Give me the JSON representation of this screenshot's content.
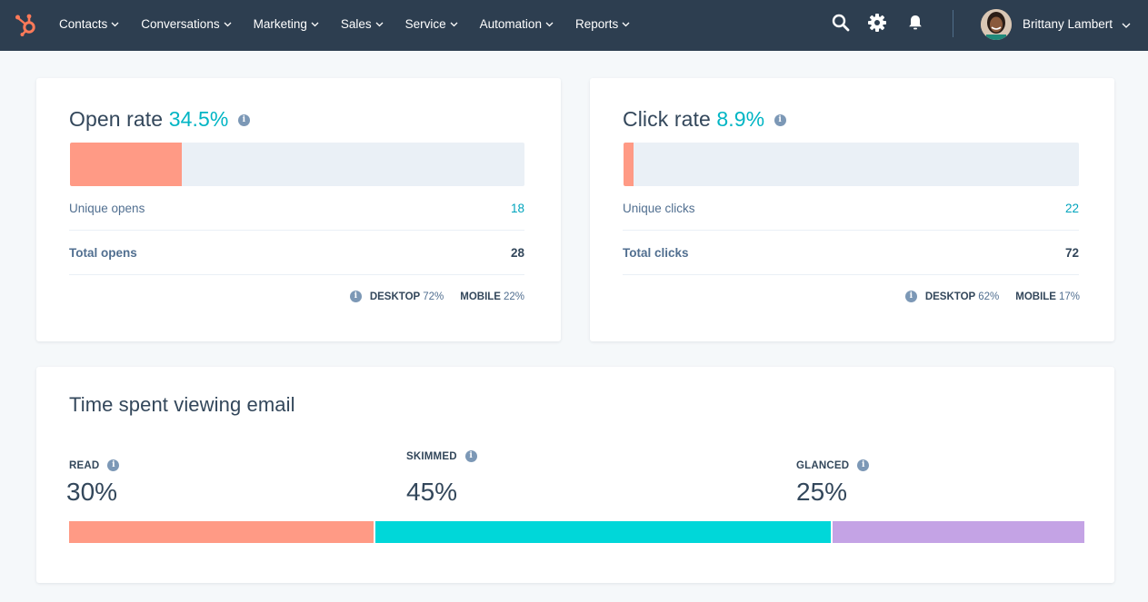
{
  "nav": {
    "logo": "hubspot-sprocket-icon",
    "menu": [
      {
        "label": "Contacts"
      },
      {
        "label": "Conversations"
      },
      {
        "label": "Marketing"
      },
      {
        "label": "Sales"
      },
      {
        "label": "Service"
      },
      {
        "label": "Automation"
      },
      {
        "label": "Reports"
      }
    ],
    "icons": [
      "search-icon",
      "gear-icon",
      "bell-icon"
    ],
    "user": {
      "name": "Brittany Lambert"
    }
  },
  "open_rate": {
    "title": "Open rate",
    "value": "34.5%",
    "fraction": 0.245,
    "rows": [
      {
        "label": "Unique opens",
        "value": "18"
      },
      {
        "label": "Total opens",
        "value": "28"
      }
    ],
    "devices": [
      {
        "label": "DESKTOP",
        "value": "72%"
      },
      {
        "label": "MOBILE",
        "value": "22%"
      }
    ]
  },
  "click_rate": {
    "title": "Click rate",
    "value": "8.9%",
    "fraction": 0.022,
    "rows": [
      {
        "label": "Unique clicks",
        "value": "22"
      },
      {
        "label": "Total clicks",
        "value": "72"
      }
    ],
    "devices": [
      {
        "label": "DESKTOP",
        "value": "62%"
      },
      {
        "label": "MOBILE",
        "value": "17%"
      }
    ]
  },
  "time_spent": {
    "title": "Time spent viewing email",
    "segments": [
      {
        "label": "READ",
        "value": "30%",
        "percent": 30,
        "color": "#ff9a85"
      },
      {
        "label": "SKIMMED",
        "value": "45%",
        "percent": 45,
        "color": "#00d7d9"
      },
      {
        "label": "GLANCED",
        "value": "25%",
        "percent": 25,
        "color": "#c4a3e5"
      }
    ]
  },
  "colors": {
    "nav_bg": "#2d3e50",
    "accent": "#00b5c4",
    "bar_fill": "#ff9a85",
    "bar_track": "#eaf0f6",
    "logo": "#ff7a59"
  }
}
